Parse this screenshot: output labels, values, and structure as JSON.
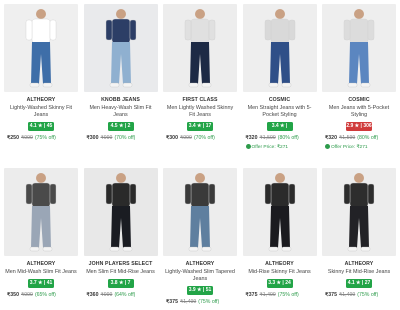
{
  "products": [
    {
      "brand": "ALTHEORY",
      "title": "Lightly-Washed Skinny Fit Jeans",
      "rating": "4.1 ★ | 45",
      "rating_color": "green",
      "price": "₹250",
      "mrp": "₹999",
      "discount": "(75% off)",
      "offer": "",
      "bg": "#efefef",
      "jeans": "#3e6ea8",
      "shirt": "#ffffff",
      "row": 1
    },
    {
      "brand": "KNOBB JEANS",
      "title": "Men Heavy-Wash Slim Fit Jeans",
      "rating": "4.5 ★ | 2",
      "rating_color": "green",
      "price": "₹300",
      "mrp": "₹999",
      "discount": "(70% off)",
      "offer": "",
      "bg": "#e9eaec",
      "jeans": "#8fb0d0",
      "shirt": "#2c3e66",
      "row": 1
    },
    {
      "brand": "FIRST CLASS",
      "title": "Men Lightly Washed Skinny Fit Jeans",
      "rating": "3.4 ★ | 17",
      "rating_color": "green",
      "price": "₹300",
      "mrp": "₹999",
      "discount": "(70% off)",
      "offer": "",
      "bg": "#ededed",
      "jeans": "#1d2a45",
      "shirt": "#e0e0e0",
      "row": 1
    },
    {
      "brand": "COSMIC",
      "title": "Men Straight Jeans with 5-Pocket Styling",
      "rating": "3.4 ★ | 2.2K",
      "rating_color": "green",
      "price": "₹320",
      "mrp": "₹1,599",
      "discount": "(80% off)",
      "offer": "Offer Price: ₹271",
      "bg": "#eeeeee",
      "jeans": "#2f4f88",
      "shirt": "#d9d9d9",
      "row": 1
    },
    {
      "brand": "COSMIC",
      "title": "Men Jeans with 5-Pocket Styling",
      "rating": "2.9 ★ | 306",
      "rating_color": "red",
      "price": "₹320",
      "mrp": "₹1,599",
      "discount": "(80% off)",
      "offer": "Offer Price: ₹271",
      "bg": "#eeeeee",
      "jeans": "#5b86c0",
      "shirt": "#dcdcdc",
      "row": 1
    },
    {
      "brand": "ALTHEORY",
      "title": "Men Mid-Wash Slim Fit Jeans",
      "rating": "3.7 ★ | 41",
      "rating_color": "green",
      "price": "₹350",
      "mrp": "₹999",
      "discount": "(65% off)",
      "offer": "",
      "bg": "#ececec",
      "jeans": "#9aa6b6",
      "shirt": "#4a4a4a",
      "row": 2
    },
    {
      "brand": "JOHN PLAYERS SELECT",
      "title": "Men Slim Fit Mid-Rise Jeans",
      "rating": "3.8 ★ | 7",
      "rating_color": "green",
      "price": "₹360",
      "mrp": "₹999",
      "discount": "(64% off)",
      "offer": "",
      "bg": "#e8e8e8",
      "jeans": "#1a1c22",
      "shirt": "#2a2a2a",
      "row": 2
    },
    {
      "brand": "ALTHEORY",
      "title": "Lightly-Washed Slim Tapered Jeans",
      "rating": "3.9 ★ | 51",
      "rating_color": "green",
      "price": "₹375",
      "mrp": "₹1,499",
      "discount": "(75% off)",
      "offer": "",
      "bg": "#ededed",
      "jeans": "#5f7f9f",
      "shirt": "#3a3a3a",
      "row": 2
    },
    {
      "brand": "ALTHEORY",
      "title": "Mid-Rise Skinny Fit Jeans",
      "rating": "3.3 ★ | 24",
      "rating_color": "green",
      "price": "₹375",
      "mrp": "₹1,499",
      "discount": "(75% off)",
      "offer": "",
      "bg": "#ededed",
      "jeans": "#1b1b1f",
      "shirt": "#2b2b2b",
      "row": 2
    },
    {
      "brand": "ALTHEORY",
      "title": "Skinny Fit Mid-Rise Jeans",
      "rating": "4.1 ★ | 27",
      "rating_color": "green",
      "price": "₹375",
      "mrp": "₹1,499",
      "discount": "(75% off)",
      "offer": "",
      "bg": "#ededed",
      "jeans": "#222226",
      "shirt": "#2d2d2d",
      "row": 2
    }
  ]
}
